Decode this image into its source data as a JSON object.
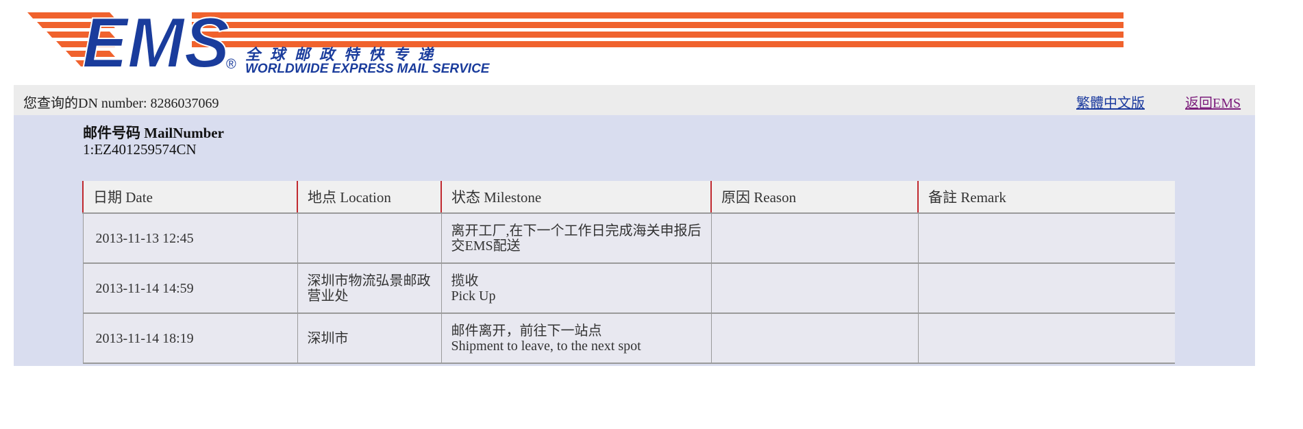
{
  "header": {
    "logo_text": "EMS",
    "logo_registered": "®",
    "tagline_cn": "全球邮政特快专递",
    "tagline_en": "WORLDWIDE EXPRESS MAIL SERVICE",
    "colors": {
      "brand_blue": "#1a3c9c",
      "brand_orange": "#f0622d"
    }
  },
  "query_bar": {
    "text": "您查询的DN number: 8286037069",
    "traditional_link": "繁體中文版",
    "back_link": "返回EMS"
  },
  "mail": {
    "label": "邮件号码 MailNumber",
    "number": "1:EZ401259574CN"
  },
  "table": {
    "headers": [
      "日期 Date",
      "地点 Location",
      "状态 Milestone",
      "原因 Reason",
      "备註 Remark"
    ],
    "rows": [
      {
        "date": "2013-11-13 12:45",
        "location": "",
        "milestone_cn": "离开工厂,在下一个工作日完成海关申报后交EMS配送",
        "milestone_en": "",
        "reason": "",
        "remark": ""
      },
      {
        "date": "2013-11-14 14:59",
        "location": "深圳市物流弘景邮政营业处",
        "milestone_cn": "揽收",
        "milestone_en": "Pick Up",
        "reason": "",
        "remark": ""
      },
      {
        "date": "2013-11-14 18:19",
        "location": "深圳市",
        "milestone_cn": "邮件离开，前往下一站点",
        "milestone_en": "Shipment to leave, to the next spot",
        "reason": "",
        "remark": ""
      }
    ]
  }
}
